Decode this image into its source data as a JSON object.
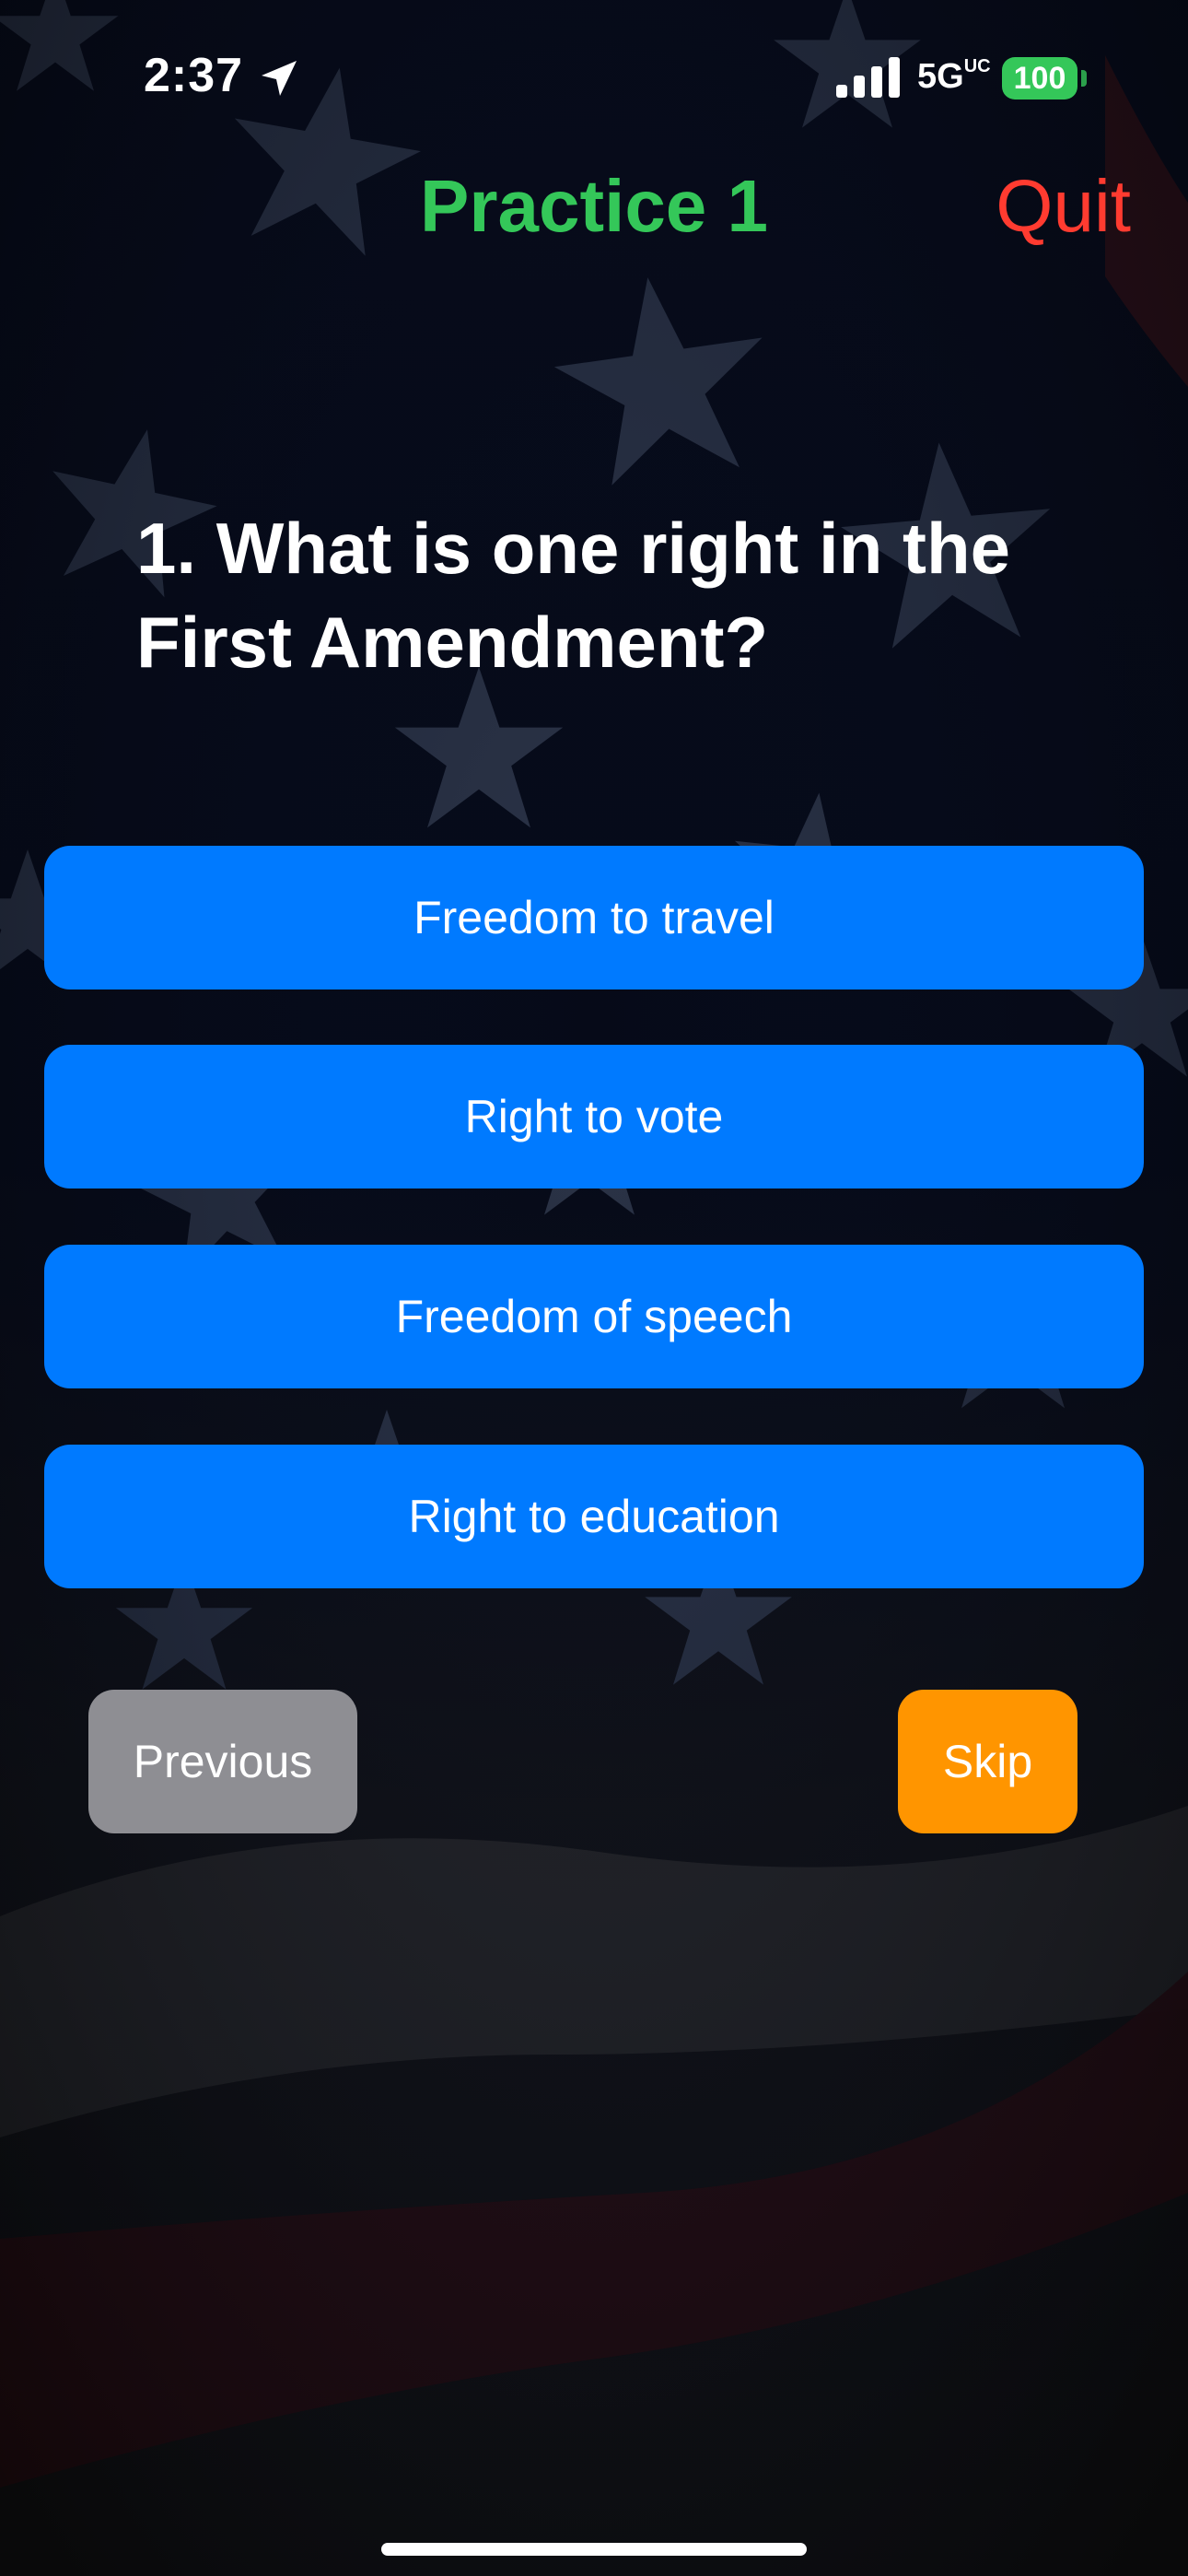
{
  "status_bar": {
    "time": "2:37",
    "network": "5G",
    "network_suffix": "UC",
    "battery": "100"
  },
  "header": {
    "title": "Practice 1",
    "quit_label": "Quit"
  },
  "question": {
    "text": "1. What is one right in the First Amendment?"
  },
  "answers": [
    {
      "label": "Freedom to travel"
    },
    {
      "label": "Right to vote"
    },
    {
      "label": "Freedom of speech"
    },
    {
      "label": "Right to education"
    }
  ],
  "footer": {
    "previous_label": "Previous",
    "skip_label": "Skip"
  },
  "colors": {
    "title": "#34c759",
    "quit": "#ff3b30",
    "answer_bg": "#007aff",
    "previous_bg": "#8e8e93",
    "skip_bg": "#ff9500",
    "battery": "#34c759"
  },
  "icons": {
    "location": "location-arrow-icon",
    "signal": "cellular-signal-icon",
    "battery": "battery-icon"
  }
}
